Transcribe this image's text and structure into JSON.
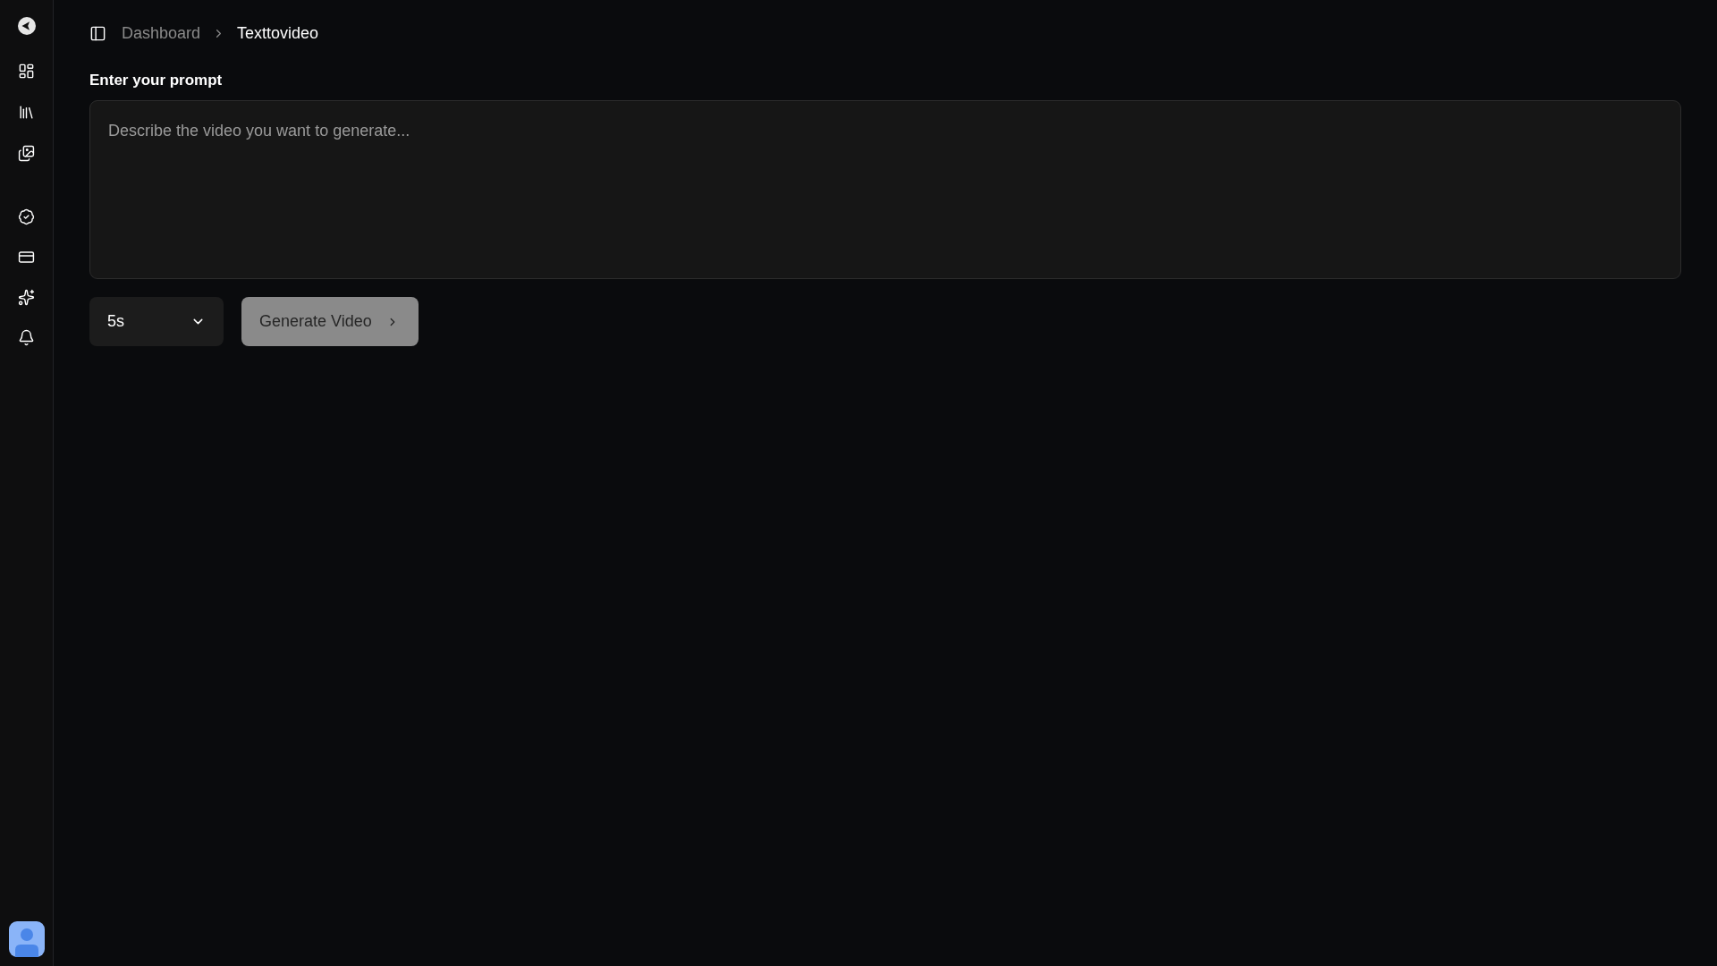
{
  "breadcrumb": [
    {
      "label": "Dashboard",
      "current": false
    },
    {
      "label": "Texttovideo",
      "current": true
    }
  ],
  "prompt": {
    "label": "Enter your prompt",
    "placeholder": "Describe the video you want to generate..."
  },
  "duration_select": {
    "value": "5s"
  },
  "generate_button": {
    "label": "Generate Video",
    "disabled": true
  }
}
